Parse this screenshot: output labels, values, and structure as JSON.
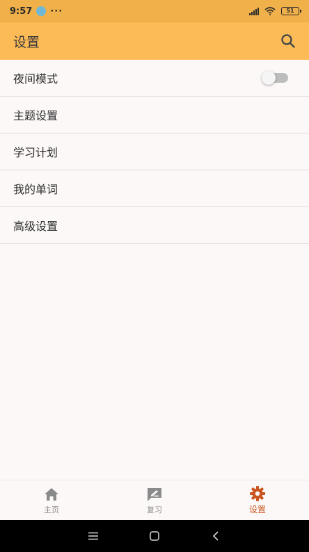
{
  "status_bar": {
    "time": "9:57",
    "dots": "···",
    "battery": "51"
  },
  "app_bar": {
    "title": "设置"
  },
  "settings": {
    "items": [
      {
        "label": "夜间模式",
        "has_toggle": true,
        "toggle_on": false
      },
      {
        "label": "主题设置"
      },
      {
        "label": "学习计划"
      },
      {
        "label": "我的单词"
      },
      {
        "label": "高级设置"
      }
    ]
  },
  "bottom_nav": {
    "items": [
      {
        "label": "主页",
        "icon": "home-icon"
      },
      {
        "label": "复习",
        "icon": "review-icon"
      },
      {
        "label": "设置",
        "icon": "settings-icon",
        "active": true
      }
    ]
  },
  "colors": {
    "status_bar": "#f0b04a",
    "app_bar": "#fdbb57",
    "active_tab": "#c9541f",
    "inactive_tab": "#8a8a8a",
    "background": "#fcf8f7"
  }
}
